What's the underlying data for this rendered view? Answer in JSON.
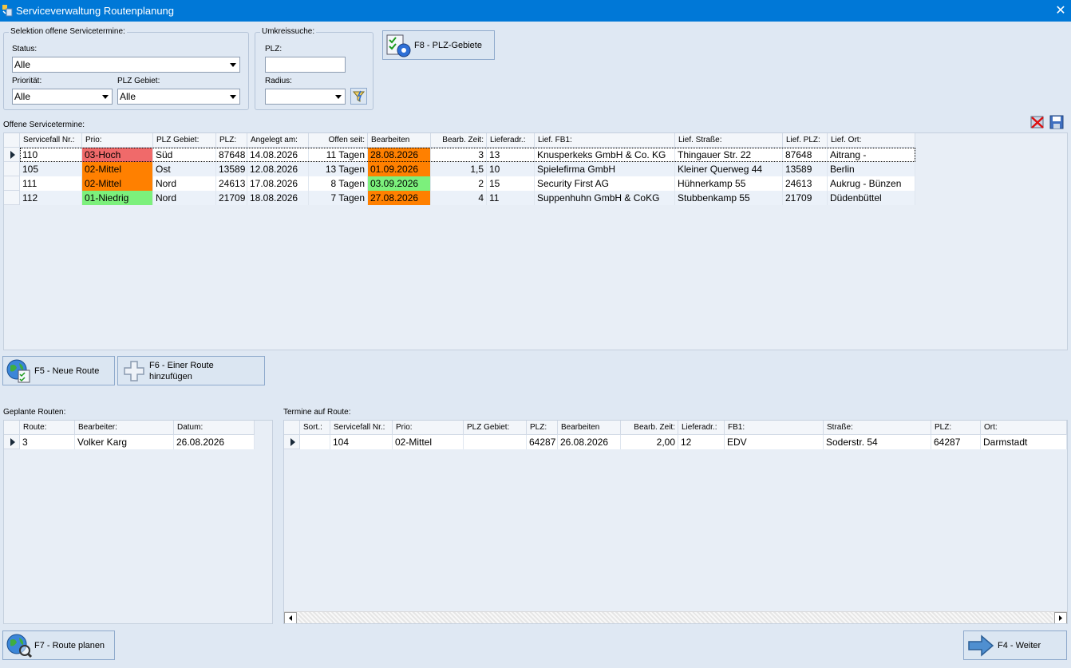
{
  "window": {
    "title": "Serviceverwaltung Routenplanung",
    "close": "✕"
  },
  "selection": {
    "title": "Selektion offene Servicetermine:",
    "status_label": "Status:",
    "status_value": "Alle",
    "prioritaet_label": "Priorität:",
    "prioritaet_value": "Alle",
    "plz_gebiet_label": "PLZ Gebiet:",
    "plz_gebiet_value": "Alle"
  },
  "umkreis": {
    "title": "Umkreissuche:",
    "plz_label": "PLZ:",
    "plz_value": "",
    "radius_label": "Radius:",
    "radius_value": ""
  },
  "buttons": {
    "f8": "F8 - PLZ-Gebiete",
    "f5": "F5 - Neue Route",
    "f6_line1": "F6 - Einer Route",
    "f6_line2": "hinzufügen",
    "f7": "F7 - Route planen",
    "f4": "F4 - Weiter"
  },
  "open_grid": {
    "label": "Offene Servicetermine:",
    "columns": [
      "Servicefall Nr.:",
      "Prio:",
      "PLZ Gebiet:",
      "PLZ:",
      "Angelegt am:",
      "Offen seit:",
      "Bearbeiten",
      "Bearb. Zeit:",
      "Lieferadr.:",
      "Lief. FB1:",
      "Lief. Straße:",
      "Lief. PLZ:",
      "Lief. Ort:"
    ],
    "rows": [
      {
        "nr": "110",
        "prio": "03-Hoch",
        "prio_color": "#f06a6a",
        "gebiet": "Süd",
        "plz": "87648",
        "angelegt": "14.08.2026",
        "offen": "11 Tagen",
        "bearbeiten": "28.08.2026",
        "bearb_color": "#ff8000",
        "zeit": "3",
        "lieferadr": "13",
        "fb1": "Knusperkeks GmbH & Co. KG",
        "strasse": "Thingauer Str. 22",
        "lplz": "87648",
        "ort": "Aitrang -"
      },
      {
        "nr": "105",
        "prio": "02-Mittel",
        "prio_color": "#ff8000",
        "gebiet": "Ost",
        "plz": "13589",
        "angelegt": "12.08.2026",
        "offen": "13 Tagen",
        "bearbeiten": "01.09.2026",
        "bearb_color": "#ff8000",
        "zeit": "1,5",
        "lieferadr": "10",
        "fb1": "Spielefirma GmbH",
        "strasse": "Kleiner Querweg 44",
        "lplz": "13589",
        "ort": "Berlin"
      },
      {
        "nr": "111",
        "prio": "02-Mittel",
        "prio_color": "#ff8000",
        "gebiet": "Nord",
        "plz": "24613",
        "angelegt": "17.08.2026",
        "offen": "8 Tagen",
        "bearbeiten": "03.09.2026",
        "bearb_color": "#7cf07c",
        "zeit": "2",
        "lieferadr": "15",
        "fb1": "Security First AG",
        "strasse": "Hühnerkamp 55",
        "lplz": "24613",
        "ort": "Aukrug - Bünzen"
      },
      {
        "nr": "112",
        "prio": "01-Niedrig",
        "prio_color": "#7cf07c",
        "gebiet": "Nord",
        "plz": "21709",
        "angelegt": "18.08.2026",
        "offen": "7 Tagen",
        "bearbeiten": "27.08.2026",
        "bearb_color": "#ff8000",
        "zeit": "4",
        "lieferadr": "11",
        "fb1": "Suppenhuhn GmbH & CoKG",
        "strasse": "Stubbenkamp 55",
        "lplz": "21709",
        "ort": "Düdenbüttel"
      }
    ]
  },
  "routes_grid": {
    "label": "Geplante Routen:",
    "columns": [
      "Route:",
      "Bearbeiter:",
      "Datum:"
    ],
    "rows": [
      {
        "route": "3",
        "bearbeiter": "Volker Karg",
        "datum": "26.08.2026"
      }
    ]
  },
  "termine_grid": {
    "label": "Termine auf Route:",
    "columns": [
      "Sort.:",
      "Servicefall Nr.:",
      "Prio:",
      "PLZ Gebiet:",
      "PLZ:",
      "Bearbeiten",
      "Bearb. Zeit:",
      "Lieferadr.:",
      "FB1:",
      "Straße:",
      "PLZ:",
      "Ort:"
    ],
    "rows": [
      {
        "sort": "",
        "nr": "104",
        "prio": "02-Mittel",
        "gebiet": "",
        "plz": "64287",
        "bearbeiten": "26.08.2026",
        "zeit": "2,00",
        "lieferadr": "12",
        "fb1": "EDV",
        "strasse": "Soderstr. 54",
        "plz2": "64287",
        "ort": "Darmstadt"
      }
    ]
  },
  "icons": {
    "app": "app-icon",
    "f8": "checklist-globe-icon",
    "f5": "globe-checklist-icon",
    "f6": "plus-icon",
    "f7": "globe-magnifier-icon",
    "f4": "arrow-right-icon",
    "clear_filter": "clear-filter-icon",
    "save": "save-icon",
    "radius_search": "lightning-filter-icon"
  }
}
